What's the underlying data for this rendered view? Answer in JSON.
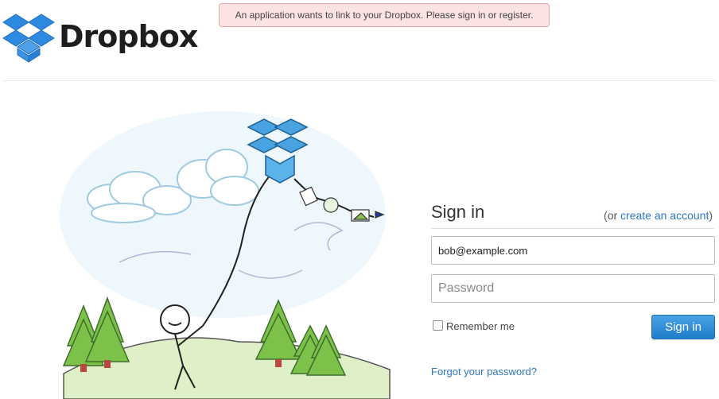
{
  "brand": {
    "name": "Dropbox",
    "logo_icon": "dropbox-box-icon",
    "logo_color": "#2e8ae0"
  },
  "notice": {
    "text": "An application wants to link to your Dropbox. Please sign in or register.",
    "background": "#fbe3e4",
    "border": "#e8a5ab"
  },
  "illustration": {
    "icon": "kite-stick-figure-illustration"
  },
  "signin": {
    "title": "Sign in",
    "alt_prefix": "(or ",
    "alt_link": "create an account",
    "alt_suffix": ")",
    "email_value": "bob@example.com",
    "password_placeholder": "Password",
    "remember_label": "Remember me",
    "remember_checked": false,
    "submit_label": "Sign in",
    "forgot_link": "Forgot your password?"
  },
  "colors": {
    "link": "#2d78c5",
    "button": "#2a85d3"
  }
}
